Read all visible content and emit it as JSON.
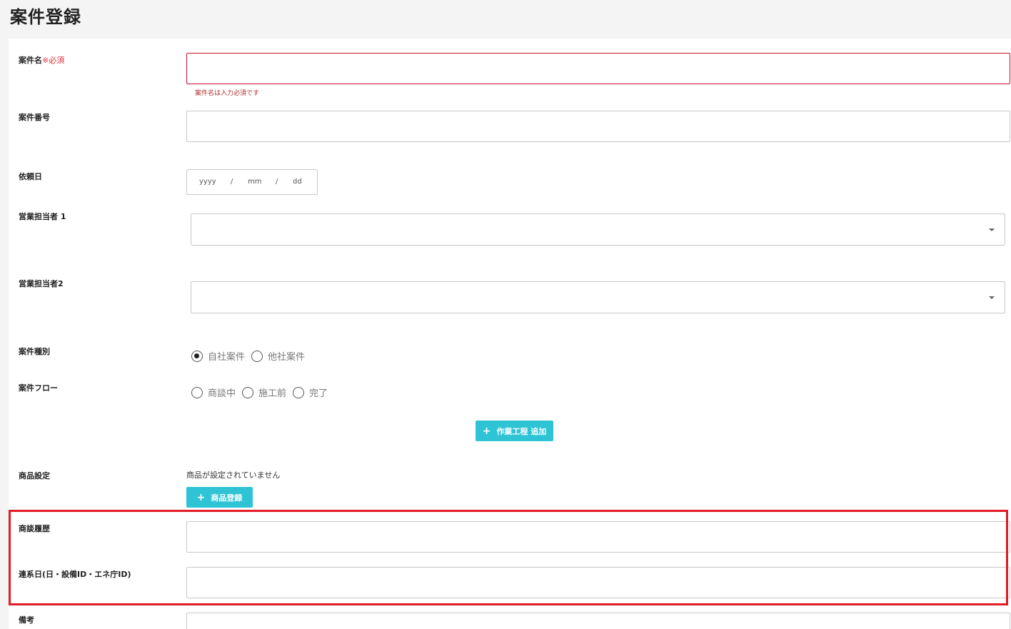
{
  "page": {
    "title": "案件登録"
  },
  "fields": {
    "case_name": {
      "label": "案件名",
      "required": "※必須",
      "value": "",
      "error": "案件名は入力必須です"
    },
    "case_number": {
      "label": "案件番号",
      "value": ""
    },
    "request_date": {
      "label": "依頼日",
      "yyyy": "yyyy",
      "sep1": "/",
      "mm": "mm",
      "sep2": "/",
      "dd": "dd"
    },
    "sales_rep1": {
      "label": "営業担当者 1",
      "value": ""
    },
    "sales_rep2": {
      "label": "営業担当者2",
      "value": ""
    },
    "case_type": {
      "label": "案件種別",
      "options": [
        "自社案件",
        "他社案件"
      ],
      "selected": "自社案件"
    },
    "case_flow": {
      "label": "案件フロー",
      "options": [
        "商談中",
        "施工前",
        "完了"
      ],
      "selected": ""
    },
    "product": {
      "label": "商品設定",
      "empty_text": "商品が設定されていません"
    },
    "negotiation_history": {
      "label": "商談履歴",
      "value": ""
    },
    "grid_date": {
      "label": "連系日(日・設備ID・エネ庁ID)",
      "value": ""
    },
    "notes": {
      "label": "備考",
      "value": ""
    }
  },
  "buttons": {
    "add_process": "作業工程 追加",
    "register_product": "商品登録"
  },
  "colors": {
    "accent": "#2ec4d6",
    "error": "#c8102e",
    "highlight": "#e21b25"
  }
}
